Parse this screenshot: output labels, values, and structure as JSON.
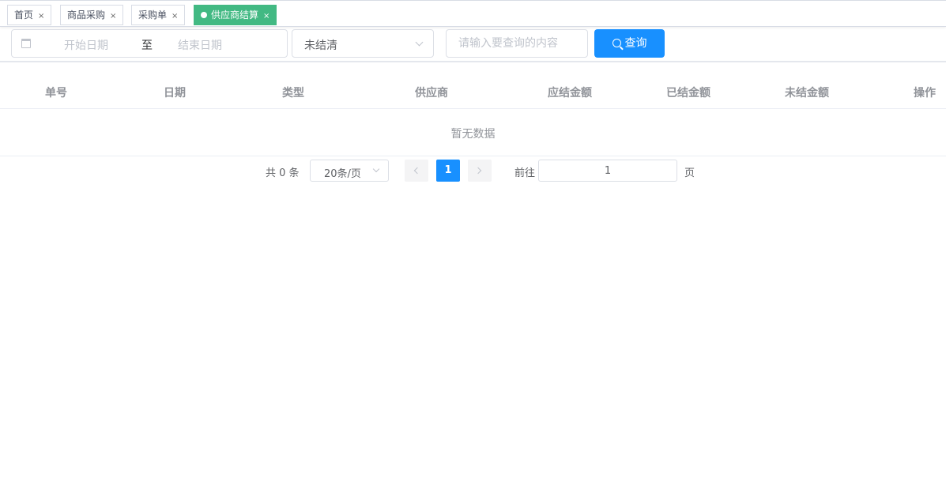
{
  "tags": [
    {
      "label": "首页"
    },
    {
      "label": "商品采购"
    },
    {
      "label": "采购单"
    },
    {
      "label": "供应商结算"
    }
  ],
  "tag_close_glyph": "×",
  "filter": {
    "start_placeholder": "开始日期",
    "range_separator": "至",
    "end_placeholder": "结束日期",
    "status_value": "未结清",
    "search_placeholder": "请输入要查询的内容",
    "query_label": "查询"
  },
  "table": {
    "columns": [
      "单号",
      "日期",
      "类型",
      "供应商",
      "应结金额",
      "已结金额",
      "未结金额",
      "操作"
    ],
    "rows": [],
    "empty_text": "暂无数据"
  },
  "pagination": {
    "total_text": "共 0 条",
    "page_size": "20条/页",
    "current_page": "1",
    "goto_label": "前往",
    "goto_value": "1",
    "page_unit": "页"
  },
  "colors": {
    "active_tag": "#42b983",
    "primary": "#1890ff"
  }
}
